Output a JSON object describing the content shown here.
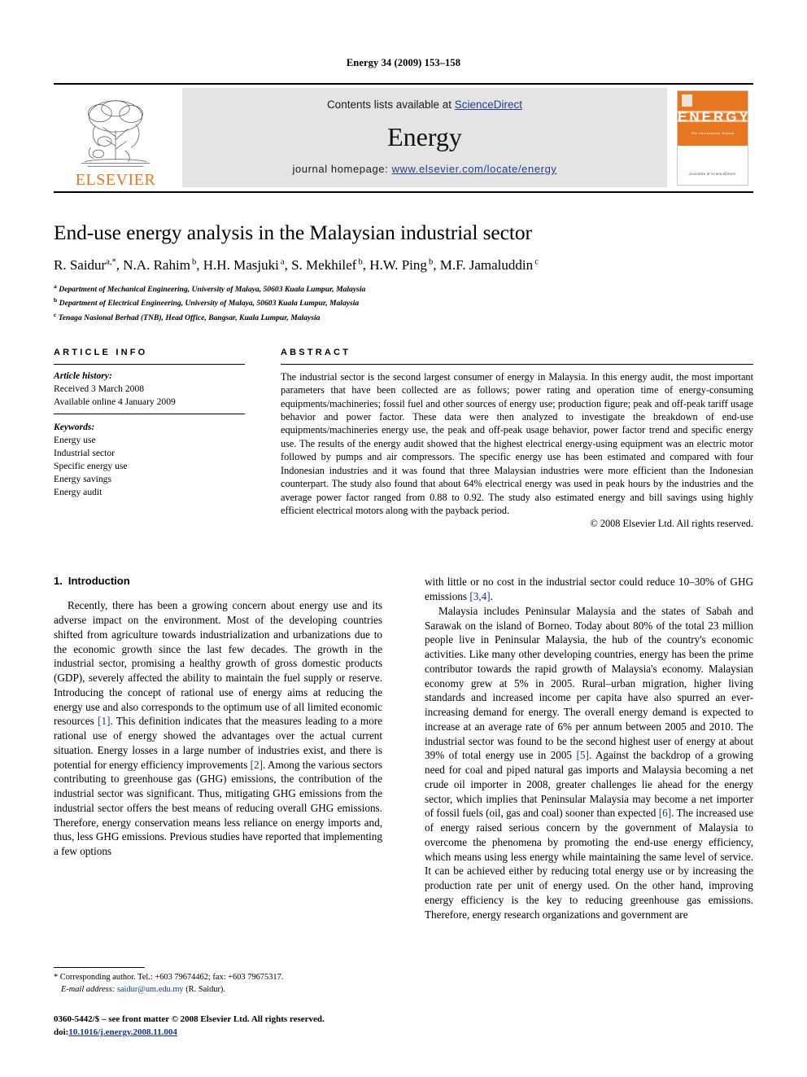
{
  "running_head": "Energy 34 (2009) 153–158",
  "masthead": {
    "publisher_name": "ELSEVIER",
    "contents_prefix": "Contents lists available at ",
    "contents_link": "ScienceDirect",
    "journal_name": "Energy",
    "homepage_prefix": "journal homepage: ",
    "homepage_url": "www.elsevier.com/locate/energy",
    "cover": {
      "title": "ENERGY",
      "subtitle": "The International Journal",
      "bottom_mark": "available at\nScienceDirect"
    }
  },
  "article": {
    "title": "End-use energy analysis in the Malaysian industrial sector",
    "authors": "R. Saidur a,*, N.A. Rahim b, H.H. Masjuki a, S. Mekhilef b, H.W. Ping b, M.F. Jamaluddin c",
    "affiliations": [
      "Department of Mechanical Engineering, University of Malaya, 50603 Kuala Lumpur, Malaysia",
      "Department of Electrical Engineering, University of Malaya, 50603 Kuala Lumpur, Malaysia",
      "Tenaga Nasional Berhad (TNB), Head Office, Bangsar, Kuala Lumpur, Malaysia"
    ],
    "affiliation_marks": [
      "a",
      "b",
      "c"
    ]
  },
  "article_info": {
    "label": "ARTICLE INFO",
    "history_label": "Article history:",
    "history": [
      "Received 3 March 2008",
      "Available online 4 January 2009"
    ],
    "keywords_label": "Keywords:",
    "keywords": [
      "Energy use",
      "Industrial sector",
      "Specific energy use",
      "Energy savings",
      "Energy audit"
    ]
  },
  "abstract": {
    "label": "ABSTRACT",
    "text": "The industrial sector is the second largest consumer of energy in Malaysia. In this energy audit, the most important parameters that have been collected are as follows; power rating and operation time of energy-consuming equipments/machineries; fossil fuel and other sources of energy use; production figure; peak and off-peak tariff usage behavior and power factor. These data were then analyzed to investigate the breakdown of end-use equipments/machineries energy use, the peak and off-peak usage behavior, power factor trend and specific energy use. The results of the energy audit showed that the highest electrical energy-using equipment was an electric motor followed by pumps and air compressors. The specific energy use has been estimated and compared with four Indonesian industries and it was found that three Malaysian industries were more efficient than the Indonesian counterpart. The study also found that about 64% electrical energy was used in peak hours by the industries and the average power factor ranged from 0.88 to 0.92. The study also estimated energy and bill savings using highly efficient electrical motors along with the payback period.",
    "copyright": "© 2008 Elsevier Ltd. All rights reserved."
  },
  "sections": {
    "intro_number": "1.",
    "intro_title": "Introduction"
  },
  "body": {
    "left_paragraph_1": "Recently, there has been a growing concern about energy use and its adverse impact on the environment. Most of the developing countries shifted from agriculture towards industrialization and urbanizations due to the economic growth since the last few decades. The growth in the industrial sector, promising a healthy growth of gross domestic products (GDP), severely affected the ability to maintain the fuel supply or reserve. Introducing the concept of rational use of energy aims at reducing the energy use and also corresponds to the optimum use of all limited economic resources [1]. This definition indicates that the measures leading to a more rational use of energy showed the advantages over the actual current situation. Energy losses in a large number of industries exist, and there is potential for energy efficiency improvements [2]. Among the various sectors contributing to greenhouse gas (GHG) emissions, the contribution of the industrial sector was significant. Thus, mitigating GHG emissions from the industrial sector offers the best means of reducing overall GHG emissions. Therefore, energy conservation means less reliance on energy imports and, thus, less GHG emissions. Previous studies have reported that implementing a few options",
    "right_paragraph_1": "with little or no cost in the industrial sector could reduce 10–30% of GHG emissions [3,4].",
    "right_paragraph_2": "Malaysia includes Peninsular Malaysia and the states of Sabah and Sarawak on the island of Borneo. Today about 80% of the total 23 million people live in Peninsular Malaysia, the hub of the country's economic activities. Like many other developing countries, energy has been the prime contributor towards the rapid growth of Malaysia's economy. Malaysian economy grew at 5% in 2005. Rural–urban migration, higher living standards and increased income per capita have also spurred an ever-increasing demand for energy. The overall energy demand is expected to increase at an average rate of 6% per annum between 2005 and 2010. The industrial sector was found to be the second highest user of energy at about 39% of total energy use in 2005 [5]. Against the backdrop of a growing need for coal and piped natural gas imports and Malaysia becoming a net crude oil importer in 2008, greater challenges lie ahead for the energy sector, which implies that Peninsular Malaysia may become a net importer of fossil fuels (oil, gas and coal) sooner than expected [6]. The increased use of energy raised serious concern by the government of Malaysia to overcome the phenomena by promoting the end-use energy efficiency, which means using less energy while maintaining the same level of service. It can be achieved either by reducing total energy use or by increasing the production rate per unit of energy used. On the other hand, improving energy efficiency is the key to reducing greenhouse gas emissions. Therefore, energy research organizations and government are"
  },
  "footnote": {
    "corresponding": "* Corresponding author. Tel.: +603 79674462; fax: +603 79675317.",
    "email_label": "E-mail address:",
    "email": "saidur@um.edu.my",
    "email_suffix": "(R. Saidur)."
  },
  "imprint": {
    "line1": "0360-5442/$ – see front matter © 2008 Elsevier Ltd. All rights reserved.",
    "doi_label": "doi:",
    "doi": "10.1016/j.energy.2008.11.004"
  },
  "colors": {
    "elsevier_orange": "#E87722",
    "link_blue": "#2a3b8f",
    "reference_blue": "#16378a",
    "banner_gray": "#e4e4e4"
  }
}
